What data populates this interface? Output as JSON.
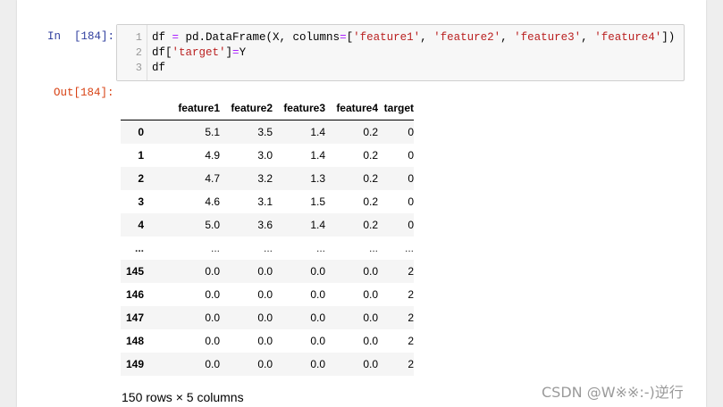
{
  "input_cell": {
    "prompt": "In  [184]:",
    "line_numbers": [
      "1",
      "2",
      "3"
    ],
    "code": {
      "line1": {
        "a": "df ",
        "eq": "=",
        "b": " pd.DataFrame(X, columns",
        "eq2": "=",
        "c": "[",
        "s1": "'feature1'",
        "d": ", ",
        "s2": "'feature2'",
        "e": ", ",
        "s3": "'feature3'",
        "f": ", ",
        "s4": "'feature4'",
        "g": "])"
      },
      "line2": {
        "a": "df[",
        "s1": "'target'",
        "b": "]",
        "eq": "=",
        "c": "Y"
      },
      "line3": "df"
    }
  },
  "output_cell": {
    "prompt": "Out[184]:",
    "table": {
      "columns": [
        "",
        "feature1",
        "feature2",
        "feature3",
        "feature4",
        "target"
      ],
      "rows": [
        [
          "0",
          "5.1",
          "3.5",
          "1.4",
          "0.2",
          "0"
        ],
        [
          "1",
          "4.9",
          "3.0",
          "1.4",
          "0.2",
          "0"
        ],
        [
          "2",
          "4.7",
          "3.2",
          "1.3",
          "0.2",
          "0"
        ],
        [
          "3",
          "4.6",
          "3.1",
          "1.5",
          "0.2",
          "0"
        ],
        [
          "4",
          "5.0",
          "3.6",
          "1.4",
          "0.2",
          "0"
        ],
        [
          "...",
          "...",
          "...",
          "...",
          "...",
          "..."
        ],
        [
          "145",
          "0.0",
          "0.0",
          "0.0",
          "0.0",
          "2"
        ],
        [
          "146",
          "0.0",
          "0.0",
          "0.0",
          "0.0",
          "2"
        ],
        [
          "147",
          "0.0",
          "0.0",
          "0.0",
          "0.0",
          "2"
        ],
        [
          "148",
          "0.0",
          "0.0",
          "0.0",
          "0.0",
          "2"
        ],
        [
          "149",
          "0.0",
          "0.0",
          "0.0",
          "0.0",
          "2"
        ]
      ]
    },
    "shape_text": "150 rows × 5 columns"
  },
  "watermark": "CSDN @W※※:-)逆行",
  "colors": {
    "in_prompt": "#303f9f",
    "out_prompt": "#d84315",
    "string": "#ba2121",
    "operator": "#aa22ff"
  }
}
